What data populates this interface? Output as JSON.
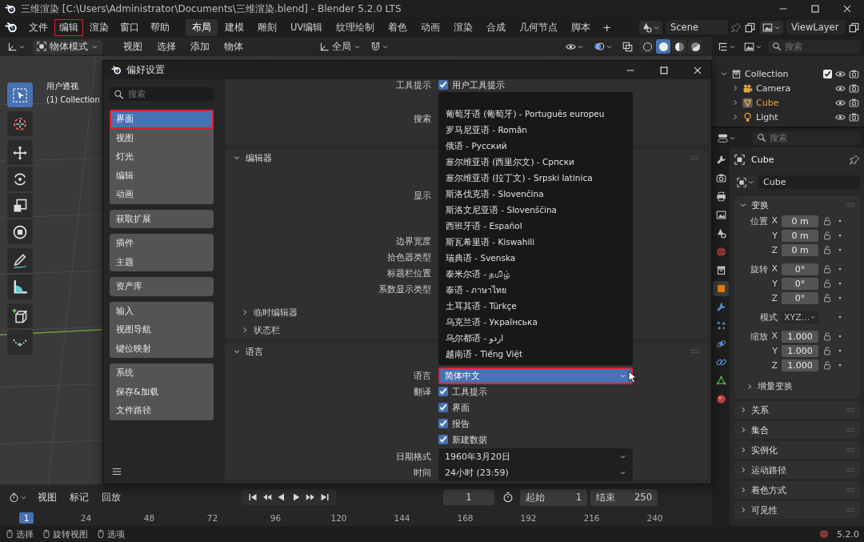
{
  "window": {
    "title": "三维渲染 [C:\\Users\\Administrator\\Documents\\三维渲染.blend] - Blender 5.2.0 LTS"
  },
  "menu": [
    {
      "label": "文件",
      "outlined": false
    },
    {
      "label": "编辑",
      "outlined": true
    },
    {
      "label": "渲染",
      "outlined": false
    },
    {
      "label": "窗口",
      "outlined": false
    },
    {
      "label": "帮助",
      "outlined": false
    }
  ],
  "workspaces": [
    {
      "label": "布局",
      "selected": true
    },
    {
      "label": "建模",
      "selected": false
    },
    {
      "label": "雕刻",
      "selected": false
    },
    {
      "label": "UV编辑",
      "selected": false
    },
    {
      "label": "纹理绘制",
      "selected": false
    },
    {
      "label": "着色",
      "selected": false
    },
    {
      "label": "动画",
      "selected": false
    },
    {
      "label": "渲染",
      "selected": false
    },
    {
      "label": "合成",
      "selected": false
    },
    {
      "label": "几何节点",
      "selected": false
    },
    {
      "label": "脚本",
      "selected": false
    }
  ],
  "add_workspace": "+",
  "scene": "Scene",
  "view_layer": "ViewLayer",
  "viewport": {
    "mode": "物体模式",
    "menus": [
      "视图",
      "选择",
      "添加",
      "物体"
    ],
    "orientation": "全局",
    "view_name": "用户透视",
    "collection": "(1) Collection",
    "tools": [
      {
        "kind": "select",
        "selected": true
      },
      {
        "kind": "cursor",
        "selected": false
      },
      {
        "kind": "move",
        "selected": false
      },
      {
        "kind": "rotate",
        "selected": false
      },
      {
        "kind": "scale",
        "selected": false
      },
      {
        "kind": "transform",
        "selected": false
      },
      {
        "kind": "annotate",
        "selected": false
      },
      {
        "kind": "measure",
        "selected": false
      },
      {
        "kind": "add-cube",
        "selected": false
      },
      {
        "kind": "curve",
        "selected": false
      }
    ],
    "shading_modes": [
      {
        "kind": "wireframe",
        "selected": false
      },
      {
        "kind": "solid",
        "selected": true
      },
      {
        "kind": "material",
        "selected": false
      },
      {
        "kind": "rendered",
        "selected": false
      }
    ]
  },
  "preferences": {
    "title": "偏好设置",
    "search_placeholder": "搜索",
    "nav_groups": [
      {
        "items": [
          {
            "label": "界面",
            "selected": true,
            "outlined": true
          },
          {
            "label": "视图",
            "selected": false,
            "outlined": false
          },
          {
            "label": "灯光",
            "selected": false,
            "outlined": false
          },
          {
            "label": "编辑",
            "selected": false,
            "outlined": false
          },
          {
            "label": "动画",
            "selected": false,
            "outlined": false
          }
        ]
      },
      {
        "items": [
          {
            "label": "获取扩展",
            "selected": false,
            "outlined": false
          }
        ]
      },
      {
        "items": [
          {
            "label": "插件",
            "selected": false,
            "outlined": false
          },
          {
            "label": "主题",
            "selected": false,
            "outlined": false
          }
        ]
      },
      {
        "items": [
          {
            "label": "资产库",
            "selected": false,
            "outlined": false
          }
        ]
      },
      {
        "items": [
          {
            "label": "输入",
            "selected": false,
            "outlined": false
          },
          {
            "label": "视图导航",
            "selected": false,
            "outlined": false
          },
          {
            "label": "键位映射",
            "selected": false,
            "outlined": false
          }
        ]
      },
      {
        "items": [
          {
            "label": "系统",
            "selected": false,
            "outlined": false
          },
          {
            "label": "保存&加载",
            "selected": false,
            "outlined": false
          },
          {
            "label": "文件路径",
            "selected": false,
            "outlined": false
          }
        ]
      }
    ],
    "tooltips": {
      "label": "工具提示",
      "option": "用户工具提示",
      "checked": true
    },
    "search_label": "搜索",
    "editors": {
      "title": "编辑器",
      "expanded": true,
      "labels": [
        "显示",
        "边界宽度",
        "拾色器类型",
        "标题栏位置",
        "系数显示类型"
      ],
      "subpanels": [
        {
          "label": "临时编辑器",
          "expanded": false
        },
        {
          "label": "状态栏",
          "expanded": false
        }
      ]
    },
    "language": {
      "title": "语言",
      "expanded": true,
      "label": "语言",
      "value": "简体中文",
      "outlined": true,
      "translate_label": "翻译",
      "translate": [
        {
          "label": "工具提示",
          "checked": true
        },
        {
          "label": "界面",
          "checked": true
        },
        {
          "label": "报告",
          "checked": true
        },
        {
          "label": "新建数据",
          "checked": true
        }
      ],
      "date_format": {
        "label": "日期格式",
        "value": "1960年3月20日"
      },
      "time": {
        "label": "时间",
        "value": "24小时 (23:59)"
      }
    },
    "language_menu": [
      "葡萄牙语 (葡萄牙) - Português europeu",
      "罗马尼亚语 - Român",
      "俄语 - Русский",
      "塞尔维亚语 (西里尔文) - Српски",
      "塞尔维亚语 (拉丁文) - Srpski latinica",
      "斯洛伐克语 - Slovenčina",
      "斯洛文尼亚语 - Slovenščina",
      "西班牙语 - Español",
      "斯瓦希里语 - Kiswahili",
      "瑞典语 - Svenska",
      "泰米尔语 - தமிழ்",
      "泰语 - ภาษาไทย",
      "土耳其语 - Türkçe",
      "乌克兰语 - Українська",
      "乌尔都语 - اردو",
      "越南语 - Tiếng Việt"
    ]
  },
  "outliner": {
    "search_placeholder": "搜索",
    "tree": [
      {
        "label": "Collection",
        "kind": "collection",
        "expanded": true,
        "checked": true,
        "children": [
          {
            "label": "Camera",
            "kind": "camera",
            "expanded": false,
            "selected": false
          },
          {
            "label": "Cube",
            "kind": "mesh",
            "expanded": false,
            "selected": true
          },
          {
            "label": "Light",
            "kind": "light",
            "expanded": false,
            "selected": false
          }
        ]
      }
    ]
  },
  "properties": {
    "search_placeholder": "搜索",
    "tabs": [
      {
        "kind": "tool",
        "selected": false
      },
      {
        "kind": "render",
        "selected": false
      },
      {
        "kind": "output",
        "selected": false
      },
      {
        "kind": "view_layer",
        "selected": false
      },
      {
        "kind": "scene",
        "selected": false
      },
      {
        "kind": "world",
        "selected": false
      },
      {
        "kind": "collection",
        "selected": false
      },
      {
        "kind": "object",
        "selected": true
      },
      {
        "kind": "modifiers",
        "selected": false
      },
      {
        "kind": "particles",
        "selected": false
      },
      {
        "kind": "physics",
        "selected": false
      },
      {
        "kind": "constraints",
        "selected": false
      },
      {
        "kind": "data",
        "selected": false
      },
      {
        "kind": "material",
        "selected": false
      }
    ],
    "object_name": "Cube",
    "data_name": "Cube",
    "transform": {
      "title": "变换",
      "expanded": true,
      "groups": [
        {
          "label": "位置",
          "kind": "vector",
          "rows": [
            {
              "axis": "X",
              "value": "0 m"
            },
            {
              "axis": "Y",
              "value": "0 m"
            },
            {
              "axis": "Z",
              "value": "0 m"
            }
          ]
        },
        {
          "label": "旋转",
          "kind": "vector",
          "rows": [
            {
              "axis": "X",
              "value": "0°"
            },
            {
              "axis": "Y",
              "value": "0°"
            },
            {
              "axis": "Z",
              "value": "0°"
            }
          ]
        },
        {
          "label": "模式",
          "kind": "select",
          "value": "XYZ..."
        },
        {
          "label": "缩放",
          "kind": "vector",
          "rows": [
            {
              "axis": "X",
              "value": "1.000"
            },
            {
              "axis": "Y",
              "value": "1.000"
            },
            {
              "axis": "Z",
              "value": "1.000"
            }
          ]
        }
      ],
      "delta": {
        "label": "增量变换",
        "expanded": false
      }
    },
    "panels": [
      {
        "label": "关系",
        "expanded": false
      },
      {
        "label": "集合",
        "expanded": false
      },
      {
        "label": "实例化",
        "expanded": false
      },
      {
        "label": "运动路径",
        "expanded": false
      },
      {
        "label": "着色方式",
        "expanded": false
      },
      {
        "label": "可见性",
        "expanded": false
      }
    ]
  },
  "timeline": {
    "menus": [
      "视图",
      "标记",
      "回放"
    ],
    "current_frame": "1",
    "start": {
      "label": "起始",
      "value": "1"
    },
    "end": {
      "label": "结束",
      "value": "250"
    },
    "playhead": "1",
    "ruler": [
      "24",
      "48",
      "72",
      "96",
      "120",
      "144",
      "168",
      "192",
      "216",
      "240"
    ]
  },
  "status_bar": {
    "hints": [
      "选择",
      "旋转视图",
      "选项"
    ],
    "version": "5.2.0"
  }
}
